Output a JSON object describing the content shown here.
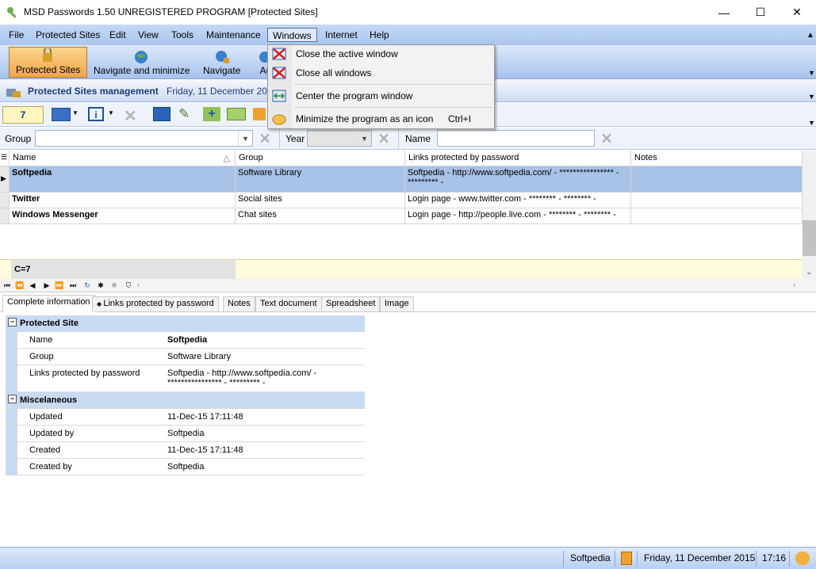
{
  "window": {
    "title": "MSD Passwords 1.50 UNREGISTERED PROGRAM [Protected Sites]",
    "minimize": "—",
    "maximize": "☐",
    "close": "✕"
  },
  "menubar": [
    "File",
    "Protected Sites",
    "Edit",
    "View",
    "Tools",
    "Maintenance",
    "Windows",
    "Internet",
    "Help"
  ],
  "toolbar": {
    "protected_sites": "Protected Sites",
    "navigate_minimize": "Navigate and minimize",
    "navigate": "Navigate",
    "auto_partial": "Au"
  },
  "section": {
    "title": "Protected Sites management",
    "date": "Friday, 11 December 20"
  },
  "counter": "7",
  "filter": {
    "group_label": "Group",
    "year_label": "Year",
    "name_label": "Name"
  },
  "grid": {
    "headers": [
      "Name",
      "Group",
      "Links protected by password",
      "Notes"
    ],
    "rows": [
      {
        "name": "Softpedia",
        "group": "Software Library",
        "links": "Softpedia - http://www.softpedia.com/ - **************** - ********* -",
        "notes": ""
      },
      {
        "name": "Twitter",
        "group": "Social sites",
        "links": "Login page - www.twitter.com - ******** - ******** -",
        "notes": ""
      },
      {
        "name": "Windows Messenger",
        "group": "Chat sites",
        "links": "Login page - http://people.live.com - ******** - ******** -",
        "notes": ""
      }
    ],
    "footer": "C=7"
  },
  "tabs": [
    "Complete information",
    "Links protected by password",
    "Notes",
    "Text document",
    "Spreadsheet",
    "Image"
  ],
  "details": {
    "cat1": "Protected Site",
    "name_label": "Name",
    "name_value": "Softpedia",
    "group_label": "Group",
    "group_value": "Software Library",
    "links_label": "Links protected by password",
    "links_value": "Softpedia - http://www.softpedia.com/ - **************** - ********* -",
    "cat2": "Miscelaneous",
    "updated_label": "Updated",
    "updated_value": "11-Dec-15 17:11:48",
    "updated_by_label": "Updated by",
    "updated_by_value": "Softpedia",
    "created_label": "Created",
    "created_value": "11-Dec-15 17:11:48",
    "created_by_label": "Created by",
    "created_by_value": "Softpedia"
  },
  "status": {
    "user": "Softpedia",
    "date": "Friday, 11 December 2015",
    "time": "17:16"
  },
  "windows_menu": {
    "close_active": "Close the active window",
    "close_all": "Close all windows",
    "center": "Center the program window",
    "minimize_icon": "Minimize the program as an icon",
    "minimize_shortcut": "Ctrl+I"
  },
  "colors": {
    "menubar": "#b6cef2",
    "selected_row": "#a8c2e8",
    "highlight_button": "#f3a44a",
    "counter_bg": "#fff5bf"
  }
}
